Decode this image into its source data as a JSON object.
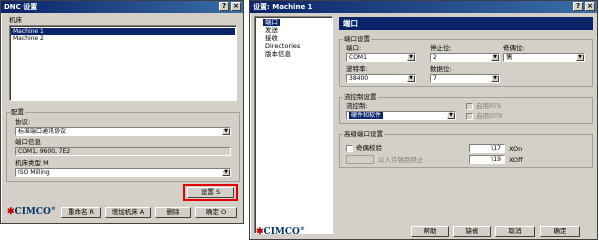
{
  "left_window": {
    "title": "DNC 设置",
    "machines_label": "机床",
    "machines": [
      "Machine 1",
      "Machine 2"
    ],
    "config_label": "配置",
    "protocol_label": "协议:",
    "protocol_value": "标准端口通讯协议",
    "port_info_label": "端口信息",
    "port_info_value": "COM1, 9600, 7E2",
    "machine_type_label": "机床类型 M",
    "machine_type_value": "ISO Milling",
    "settings_button": "设置 S",
    "rename_button": "重命名 R",
    "add_machine_button": "增加机床 A",
    "delete_button": "删除",
    "ok_button": "确定 O",
    "logo_text": "CIMCO"
  },
  "right_window": {
    "title": "设置: Machine 1",
    "tree": [
      "端口",
      "发送",
      "接收",
      "Directories",
      "版本信息"
    ],
    "panel_title": "端口",
    "port_group_label": "端口设置",
    "port_label": "端口:",
    "port_value": "COM1",
    "stop_bits_label": "停止位:",
    "stop_bits_value": "2",
    "parity_label": "奇偶位:",
    "parity_value": "偶",
    "baud_label": "波特率:",
    "baud_value": "38400",
    "data_bits_label": "数据位:",
    "data_bits_value": "7",
    "flow_group_label": "流控制设置",
    "flow_label": "流控制:",
    "flow_value": "硬件和软件",
    "rts_label": "启用RTS",
    "dtr_label": "启用DTR",
    "advanced_group_label": "高级端口设置",
    "parity_check_label": "奇偶校验",
    "parity_check_sub": "以入许强制禁止",
    "xon_value": "\\17",
    "xon_label": "XOn",
    "xoff_value": "\\19",
    "xoff_label": "XOff",
    "help_button": "帮助",
    "default_button": "缺省",
    "cancel_button": "取消",
    "ok_button": "确定",
    "logo_text": "CIMCO"
  },
  "colors": {
    "titlebar": "#0a246a",
    "highlight_border": "#e00000",
    "selection": "#0a246a"
  }
}
